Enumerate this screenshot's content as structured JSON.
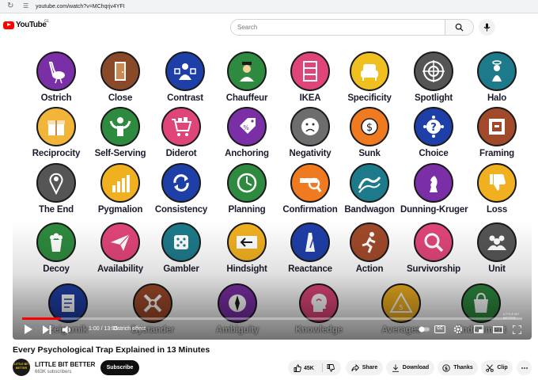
{
  "browser": {
    "url": "youtube.com/watch?v=MChqrjv4YFI",
    "reload_icon": "reload-icon",
    "site_info_icon": "site-info-icon"
  },
  "masthead": {
    "logo_text": "YouTube",
    "country": "GL",
    "search_placeholder": "Search"
  },
  "video": {
    "title": "Every Psychological Trap Explained in 13 Minutes",
    "time": "1:00 / 13:05",
    "chapter": "Ostrich effect",
    "progress": 0.077,
    "watermark": "LITTLE BIT BETTER",
    "tiles": [
      {
        "label": "Ostrich",
        "bg": "#7b2fa6",
        "icon": "ostrich"
      },
      {
        "label": "Close",
        "bg": "#8a4a2a",
        "icon": "door"
      },
      {
        "label": "Contrast",
        "bg": "#1f3fa8",
        "icon": "person-box"
      },
      {
        "label": "Chauffeur",
        "bg": "#2e8a3e",
        "icon": "driver"
      },
      {
        "label": "IKEA",
        "bg": "#e0457a",
        "icon": "shelf"
      },
      {
        "label": "Specificity",
        "bg": "#f0c020",
        "icon": "armchair"
      },
      {
        "label": "Spotlight",
        "bg": "#555555",
        "icon": "target"
      },
      {
        "label": "Halo",
        "bg": "#1d7a8a",
        "icon": "halo"
      },
      {
        "label": "Reciprocity",
        "bg": "#f2b53a",
        "icon": "gift"
      },
      {
        "label": "Self-Serving",
        "bg": "#2e8a3e",
        "icon": "strongman"
      },
      {
        "label": "Diderot",
        "bg": "#e0457a",
        "icon": "cart"
      },
      {
        "label": "Anchoring",
        "bg": "#7b2fa6",
        "icon": "tag"
      },
      {
        "label": "Negativity",
        "bg": "#6d6d6d",
        "icon": "frown"
      },
      {
        "label": "Sunk",
        "bg": "#f07a20",
        "icon": "coin"
      },
      {
        "label": "Choice",
        "bg": "#1f3fa8",
        "icon": "question"
      },
      {
        "label": "Framing",
        "bg": "#a04a2a",
        "icon": "frame"
      },
      {
        "label": "The End",
        "bg": "#555555",
        "icon": "pin"
      },
      {
        "label": "Pygmalion",
        "bg": "#f0b020",
        "icon": "growth"
      },
      {
        "label": "Consistency",
        "bg": "#1f3fa8",
        "icon": "cycle"
      },
      {
        "label": "Planning",
        "bg": "#2e8a3e",
        "icon": "clock"
      },
      {
        "label": "Confirmation",
        "bg": "#f07a20",
        "icon": "magnifier"
      },
      {
        "label": "Bandwagon",
        "bg": "#1d7a8a",
        "icon": "wave"
      },
      {
        "label": "Dunning-Kruger",
        "bg": "#7b2fa6",
        "icon": "chess"
      },
      {
        "label": "Loss",
        "bg": "#f0b020",
        "icon": "thumb-down"
      },
      {
        "label": "Decoy",
        "bg": "#2e8a3e",
        "icon": "popcorn"
      },
      {
        "label": "Availability",
        "bg": "#e0457a",
        "icon": "paper-plane"
      },
      {
        "label": "Gambler",
        "bg": "#1d7a8a",
        "icon": "dice"
      },
      {
        "label": "Hindsight",
        "bg": "#f0b020",
        "icon": "arrow-back"
      },
      {
        "label": "Reactance",
        "bg": "#1f3fa8",
        "icon": "metronome"
      },
      {
        "label": "Action",
        "bg": "#a04a2a",
        "icon": "runner"
      },
      {
        "label": "Survivorship",
        "bg": "#e0457a",
        "icon": "search"
      },
      {
        "label": "Unit",
        "bg": "#555555",
        "icon": "group"
      },
      {
        "label": "Zeigarnik",
        "bg": "#1f3fa8",
        "icon": "document"
      },
      {
        "label": "Bystander",
        "bg": "#a04a2a",
        "icon": "crossed"
      },
      {
        "label": "Ambiguity",
        "bg": "#7b2fa6",
        "icon": "compass"
      },
      {
        "label": "Knowledge",
        "bg": "#e0457a",
        "icon": "head"
      },
      {
        "label": "Averages",
        "bg": "#f0b020",
        "icon": "triangle"
      },
      {
        "label": "Endowment",
        "bg": "#2e8a3e",
        "icon": "bag"
      }
    ]
  },
  "channel": {
    "name": "LITTLE BIT BETTER",
    "subscribers": "663K subscribers",
    "avatar_text": "LITTLE BIT BETTER"
  },
  "actions": {
    "subscribe": "Subscribe",
    "likes": "45K",
    "share": "Share",
    "download": "Download",
    "thanks": "Thanks",
    "clip": "Clip"
  }
}
